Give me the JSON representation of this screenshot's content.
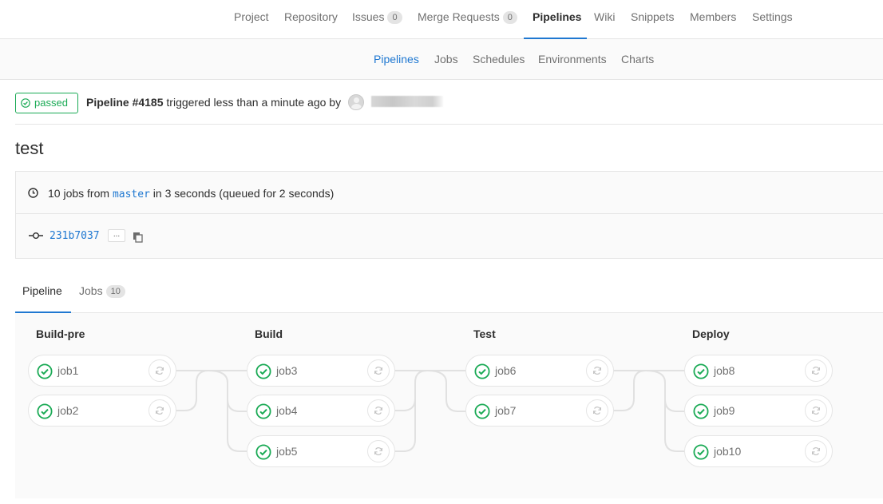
{
  "topnav": {
    "items": [
      {
        "label": "Project"
      },
      {
        "label": "Repository"
      },
      {
        "label": "Issues",
        "count": "0"
      },
      {
        "label": "Merge Requests",
        "count": "0"
      },
      {
        "label": "Pipelines"
      },
      {
        "label": "Wiki"
      },
      {
        "label": "Snippets"
      },
      {
        "label": "Members"
      },
      {
        "label": "Settings"
      }
    ]
  },
  "subnav": {
    "items": [
      {
        "label": "Pipelines"
      },
      {
        "label": "Jobs"
      },
      {
        "label": "Schedules"
      },
      {
        "label": "Environments"
      },
      {
        "label": "Charts"
      }
    ]
  },
  "pipeline": {
    "status": "passed",
    "title": "Pipeline #4185",
    "triggered_text": " triggered less than a minute ago by",
    "commit_title": "test",
    "jobs_prefix": "10 jobs from ",
    "branch": "master",
    "jobs_suffix": " in 3 seconds (queued for 2 seconds)",
    "sha": "231b7037",
    "ellipsis": "..."
  },
  "tabs": [
    {
      "label": "Pipeline"
    },
    {
      "label": "Jobs",
      "count": "10"
    }
  ],
  "stages": [
    {
      "name": "Build-pre",
      "jobs": [
        "job1",
        "job2"
      ]
    },
    {
      "name": "Build",
      "jobs": [
        "job3",
        "job4",
        "job5"
      ]
    },
    {
      "name": "Test",
      "jobs": [
        "job6",
        "job7"
      ]
    },
    {
      "name": "Deploy",
      "jobs": [
        "job8",
        "job9",
        "job10"
      ]
    }
  ],
  "colors": {
    "success": "#1aaa55",
    "link": "#1f78d1",
    "border": "#e5e5e5"
  }
}
